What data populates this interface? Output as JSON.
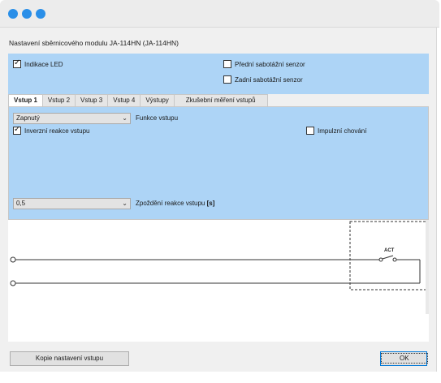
{
  "window": {
    "title": "Nastavení sběrnicového modulu JA-114HN (JA-114HN)"
  },
  "top_panel": {
    "indikace_led": {
      "label": "Indikace LED",
      "checked": true
    },
    "predni_sabotazni": {
      "label": "Přední sabotážní senzor",
      "checked": false
    },
    "zadni_sabotazni": {
      "label": "Zadní sabotážní senzor",
      "checked": false
    }
  },
  "tabs": [
    {
      "label": "Vstup 1",
      "active": true
    },
    {
      "label": "Vstup 2",
      "active": false
    },
    {
      "label": "Vstup 3",
      "active": false
    },
    {
      "label": "Vstup 4",
      "active": false
    },
    {
      "label": "Výstupy",
      "active": false
    },
    {
      "label": "Zkušební měření vstupů",
      "active": false
    }
  ],
  "input_tab": {
    "funkce_select_value": "Zapnutý",
    "funkce_label": "Funkce vstupu",
    "inverzni": {
      "label": "Inverzní reakce vstupu",
      "checked": true
    },
    "impulzni": {
      "label": "Impulzní chování",
      "checked": false
    },
    "zpozdeni_select_value": "0,5",
    "zpozdeni_label": "Zpoždění reakce vstupu",
    "zpozdeni_unit": "[s]"
  },
  "diagram": {
    "act_label": "ACT"
  },
  "buttons": {
    "copy": "Kopie nastavení vstupu",
    "ok": "OK"
  },
  "colors": {
    "panel_blue": "#add4f6",
    "titlebar_dots": "#2a8fe8"
  }
}
